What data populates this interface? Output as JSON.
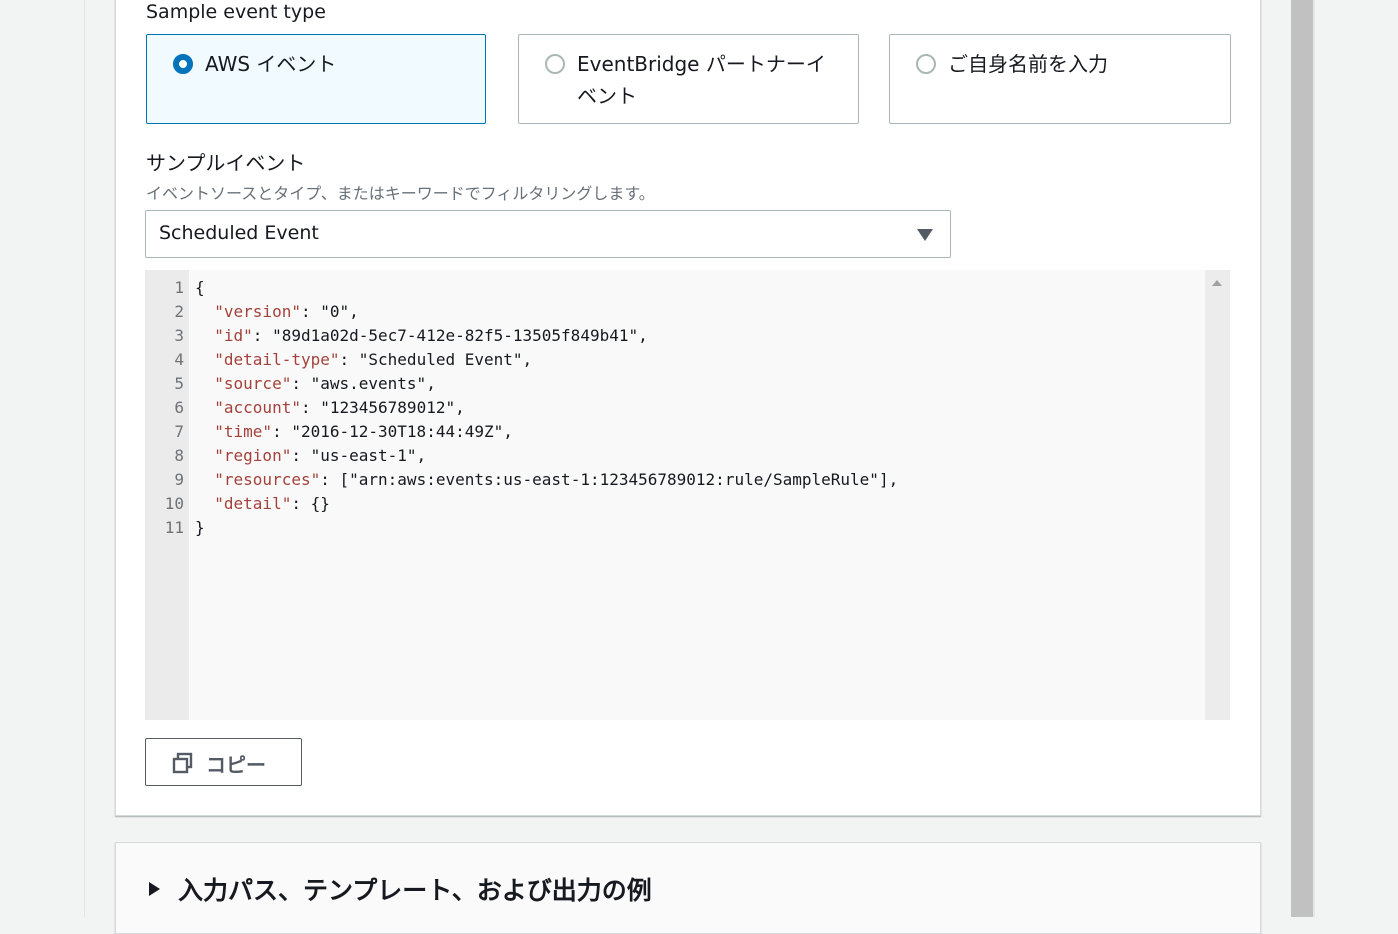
{
  "event_type": {
    "label": "Sample event type",
    "options": [
      {
        "label": "AWS イベント",
        "selected": true
      },
      {
        "label": "EventBridge パートナーイベント",
        "selected": false
      },
      {
        "label": "ご自身名前を入力",
        "selected": false
      }
    ]
  },
  "sample_event": {
    "label": "サンプルイベント",
    "description": "イベントソースとタイプ、またはキーワードでフィルタリングします。",
    "selected_value": "Scheduled Event"
  },
  "editor": {
    "lines": [
      {
        "num": "1",
        "parts": [
          {
            "t": "{"
          }
        ]
      },
      {
        "num": "2",
        "parts": [
          {
            "t": "  "
          },
          {
            "t": "\"version\"",
            "k": true
          },
          {
            "t": ": \"0\","
          }
        ]
      },
      {
        "num": "3",
        "parts": [
          {
            "t": "  "
          },
          {
            "t": "\"id\"",
            "k": true
          },
          {
            "t": ": \"89d1a02d-5ec7-412e-82f5-13505f849b41\","
          }
        ]
      },
      {
        "num": "4",
        "parts": [
          {
            "t": "  "
          },
          {
            "t": "\"detail-type\"",
            "k": true
          },
          {
            "t": ": \"Scheduled Event\","
          }
        ]
      },
      {
        "num": "5",
        "parts": [
          {
            "t": "  "
          },
          {
            "t": "\"source\"",
            "k": true
          },
          {
            "t": ": \"aws.events\","
          }
        ]
      },
      {
        "num": "6",
        "parts": [
          {
            "t": "  "
          },
          {
            "t": "\"account\"",
            "k": true
          },
          {
            "t": ": \"123456789012\","
          }
        ]
      },
      {
        "num": "7",
        "parts": [
          {
            "t": "  "
          },
          {
            "t": "\"time\"",
            "k": true
          },
          {
            "t": ": \"2016-12-30T18:44:49Z\","
          }
        ]
      },
      {
        "num": "8",
        "parts": [
          {
            "t": "  "
          },
          {
            "t": "\"region\"",
            "k": true
          },
          {
            "t": ": \"us-east-1\","
          }
        ]
      },
      {
        "num": "9",
        "parts": [
          {
            "t": "  "
          },
          {
            "t": "\"resources\"",
            "k": true
          },
          {
            "t": ": [\"arn:aws:events:us-east-1:123456789012:rule/SampleRule\"],"
          }
        ]
      },
      {
        "num": "10",
        "parts": [
          {
            "t": "  "
          },
          {
            "t": "\"detail\"",
            "k": true
          },
          {
            "t": ": {}"
          }
        ]
      },
      {
        "num": "11",
        "parts": [
          {
            "t": "}"
          }
        ]
      }
    ]
  },
  "copy_button": {
    "label": "コピー",
    "icon": "copy-icon"
  },
  "expander": {
    "title": "入力パス、テンプレート、および出力の例",
    "icon": "caret-right-icon"
  },
  "colors": {
    "accent": "#0073bb",
    "json_key": "#a3423b"
  }
}
